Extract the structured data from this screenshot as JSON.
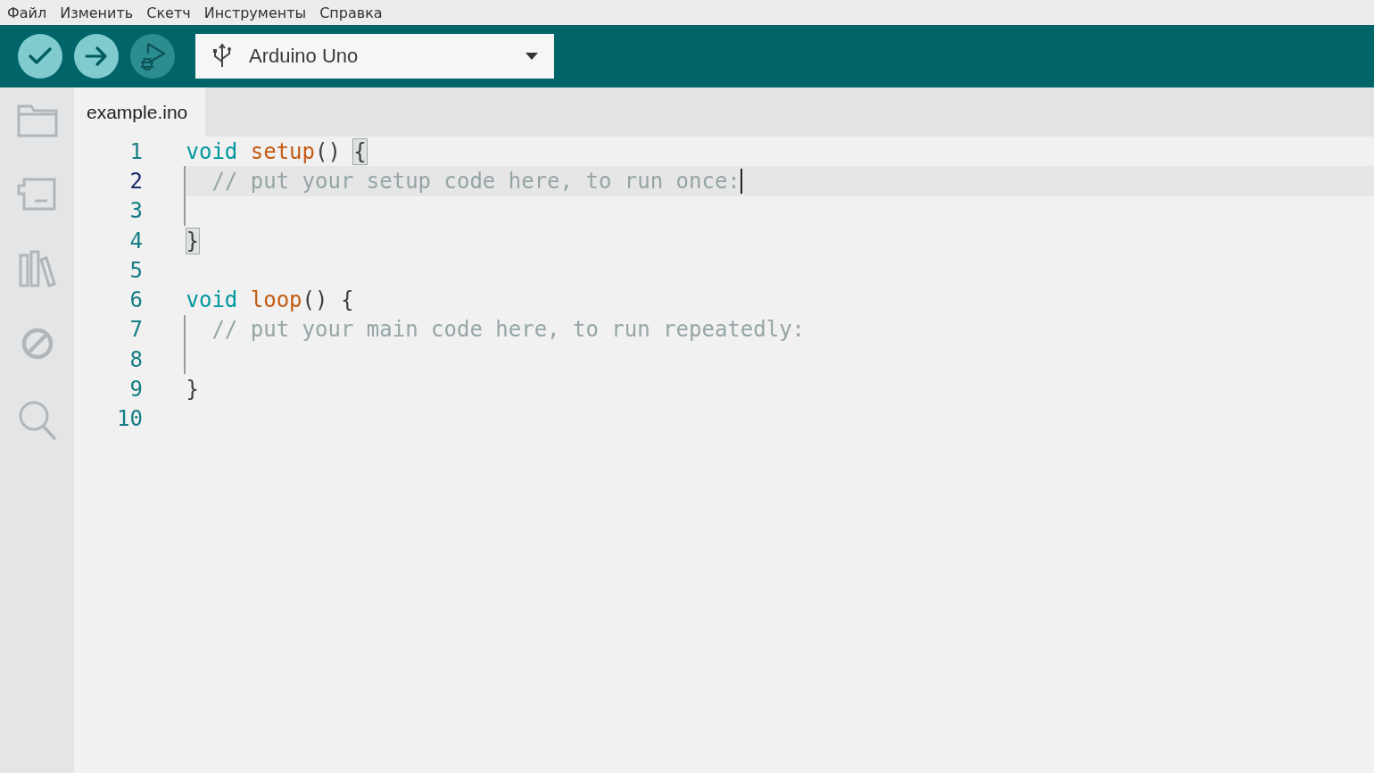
{
  "menu": [
    "Файл",
    "Изменить",
    "Скетч",
    "Инструменты",
    "Справка"
  ],
  "toolbar": {
    "buttons": [
      {
        "kind": "verify",
        "disabled": false
      },
      {
        "kind": "upload",
        "disabled": false
      },
      {
        "kind": "debug",
        "disabled": true
      }
    ],
    "board_selector": {
      "value": "Arduino Uno"
    }
  },
  "sidebar": {
    "items": [
      {
        "kind": "folder"
      },
      {
        "kind": "boards"
      },
      {
        "kind": "library"
      },
      {
        "kind": "debug"
      },
      {
        "kind": "search"
      }
    ]
  },
  "tabs": [
    {
      "label": "example.ino",
      "selected": true
    }
  ],
  "editor": {
    "lines": [
      {
        "number": "1",
        "selected": false,
        "indent_guide": false,
        "tokens": [
          {
            "kind": "keyword",
            "text": "void"
          },
          {
            "kind": "function",
            "text": " setup"
          },
          {
            "kind": "plain",
            "text": "() "
          },
          {
            "kind": "plain",
            "text": "{",
            "matched": true
          }
        ]
      },
      {
        "number": "2",
        "selected": true,
        "indent_guide": true,
        "tokens": [
          {
            "kind": "comment",
            "text": "  // put your setup code here, to run once:"
          }
        ]
      },
      {
        "number": "3",
        "selected": false,
        "indent_guide": true
      },
      {
        "number": "4",
        "selected": false,
        "indent_guide": false,
        "tokens": [
          {
            "kind": "plain",
            "text": "}",
            "matched": true
          }
        ]
      },
      {
        "number": "5",
        "selected": false,
        "indent_guide": false
      },
      {
        "number": "6",
        "selected": false,
        "indent_guide": false,
        "tokens": [
          {
            "kind": "keyword",
            "text": "void"
          },
          {
            "kind": "function",
            "text": " loop"
          },
          {
            "kind": "plain",
            "text": "() {"
          }
        ]
      },
      {
        "number": "7",
        "selected": false,
        "indent_guide": true,
        "tokens": [
          {
            "kind": "comment",
            "text": "  // put your main code here, to run repeatedly:"
          }
        ]
      },
      {
        "number": "8",
        "selected": false,
        "indent_guide": true
      },
      {
        "number": "9",
        "selected": false,
        "indent_guide": false,
        "tokens": [
          {
            "kind": "plain",
            "text": "}"
          }
        ]
      },
      {
        "number": "10",
        "selected": false,
        "indent_guide": false
      }
    ]
  }
}
